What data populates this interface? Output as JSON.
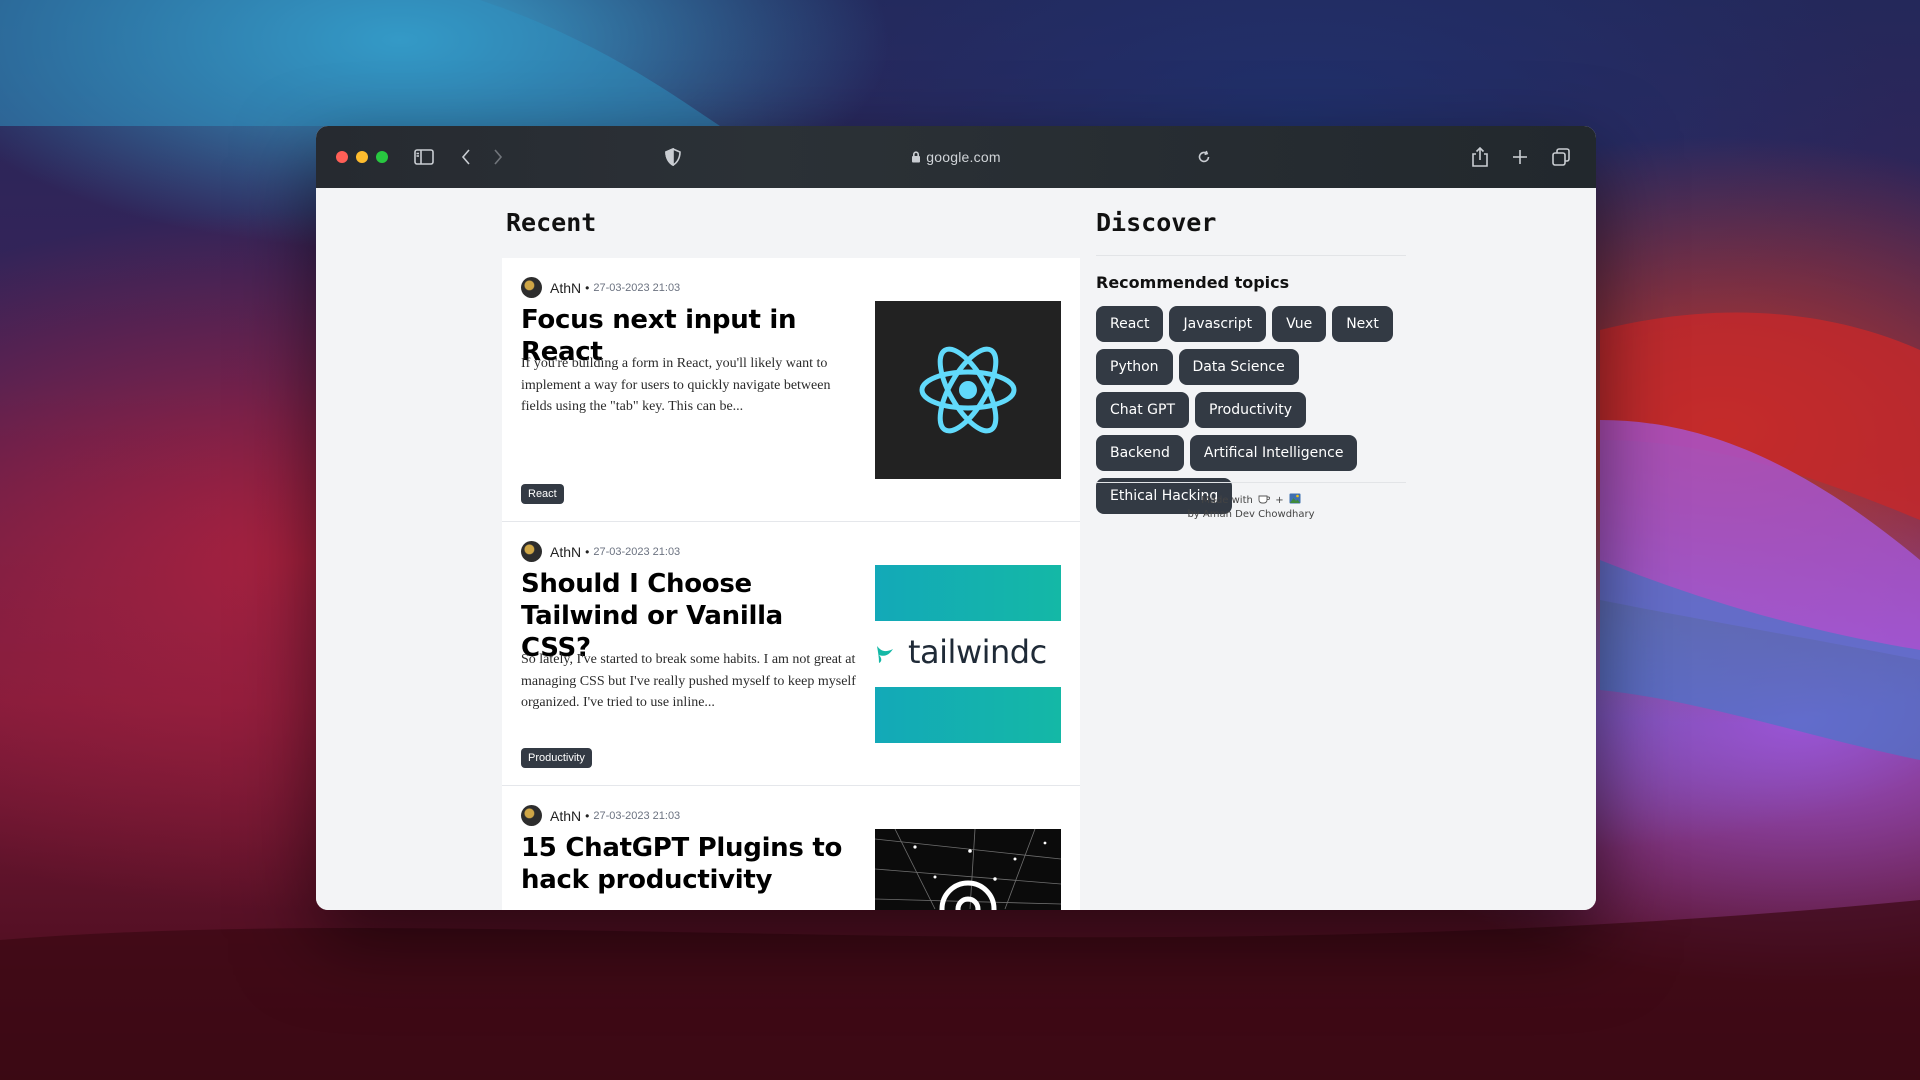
{
  "browser": {
    "url": "google.com",
    "traffic_lights": [
      "#ff5f57",
      "#febc2e",
      "#28c840"
    ]
  },
  "recent": {
    "heading": "Recent",
    "articles": [
      {
        "author": "AthN",
        "separator": "•",
        "date": "27-03-2023 21:03",
        "title": "Focus next input in React",
        "excerpt": "If you're building a form in React, you'll likely want to implement a way for users to quickly navigate between fields using the \"tab\" key. This can be...",
        "tag": "React",
        "image": "react-logo"
      },
      {
        "author": "AthN",
        "separator": "•",
        "date": "27-03-2023 21:03",
        "title": "Should I Choose Tailwind or Vanilla CSS?",
        "excerpt": "So lately, I've started to break some habits. I am not great at managing CSS but I've really pushed myself to keep myself organized. I've tried to use inline...",
        "tag": "Productivity",
        "image": "tailwind-logo",
        "image_text": "tailwindc"
      },
      {
        "author": "AthN",
        "separator": "•",
        "date": "27-03-2023 21:03",
        "title": "15 ChatGPT Plugins to hack productivity",
        "image": "openai-logo"
      }
    ]
  },
  "discover": {
    "heading": "Discover",
    "topics_title": "Recommended topics",
    "topics": [
      "React",
      "Javascript",
      "Vue",
      "Next",
      "Python",
      "Data Science",
      "Chat GPT",
      "Productivity",
      "Backend",
      "Artifical Intelligence",
      "Ethical Hacking"
    ],
    "footer_line1": "Made with",
    "footer_plus": "+",
    "footer_line2": "by Aman Dev Chowdhary"
  }
}
